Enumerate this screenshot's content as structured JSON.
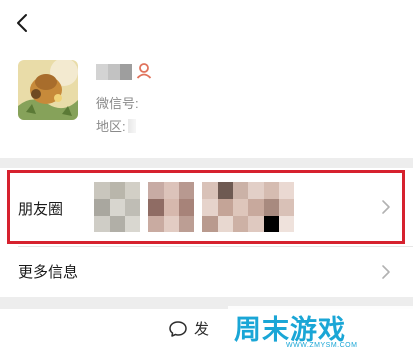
{
  "header": {
    "back_icon": "chevron-left-icon"
  },
  "profile": {
    "nickname_redacted": true,
    "gender_icon": "person-female-icon",
    "gender_color": "#e0735c",
    "wechat_id_label": "微信号:",
    "region_label": "地区:"
  },
  "moments": {
    "label": "朋友圈",
    "thumbnails_blurred": 4,
    "chevron_icon": "chevron-right-icon",
    "highlight_color": "#d6212e"
  },
  "more_info": {
    "label": "更多信息",
    "chevron_icon": "chevron-right-icon"
  },
  "actions": {
    "send_message_label": "发",
    "send_message_icon": "chat-bubble-icon"
  },
  "watermark": {
    "title": "周末游戏",
    "url": "WWW.ZMYSM.COM",
    "color": "#1aa6d6"
  }
}
